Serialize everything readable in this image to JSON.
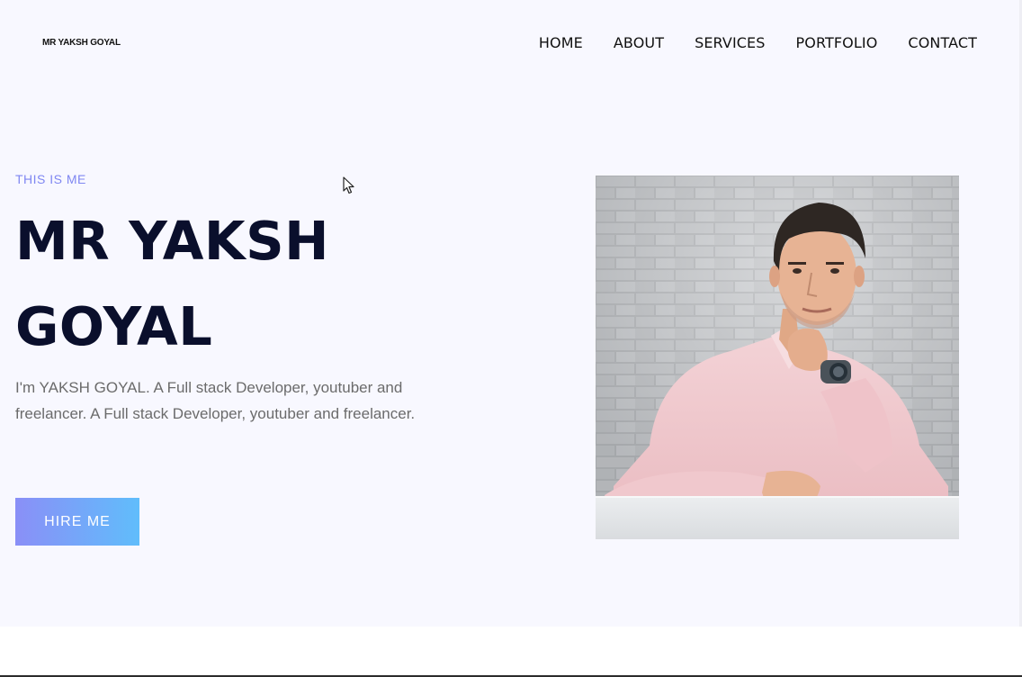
{
  "header": {
    "logo": "MR YAKSH GOYAL",
    "nav": [
      "HOME",
      "ABOUT",
      "SERVICES",
      "PORTFOLIO",
      "CONTACT"
    ]
  },
  "hero": {
    "eyebrow": "THIS IS ME",
    "title": "MR YAKSH GOYAL",
    "description": "I'm YAKSH GOYAL. A Full stack Developer, youtuber and freelancer. A Full stack Developer, youtuber and freelancer.",
    "cta_label": "HIRE ME",
    "photo_icon": "person-portrait-photo"
  },
  "colors": {
    "hero_background": "#f8f8ff",
    "title": "#0a0f2c",
    "eyebrow": "#7f87f2",
    "button_gradient_start": "#8a8ff7",
    "button_gradient_end": "#60bdfb",
    "body_text": "#6b6b6b"
  },
  "cursor_icon": "mouse-pointer-icon"
}
